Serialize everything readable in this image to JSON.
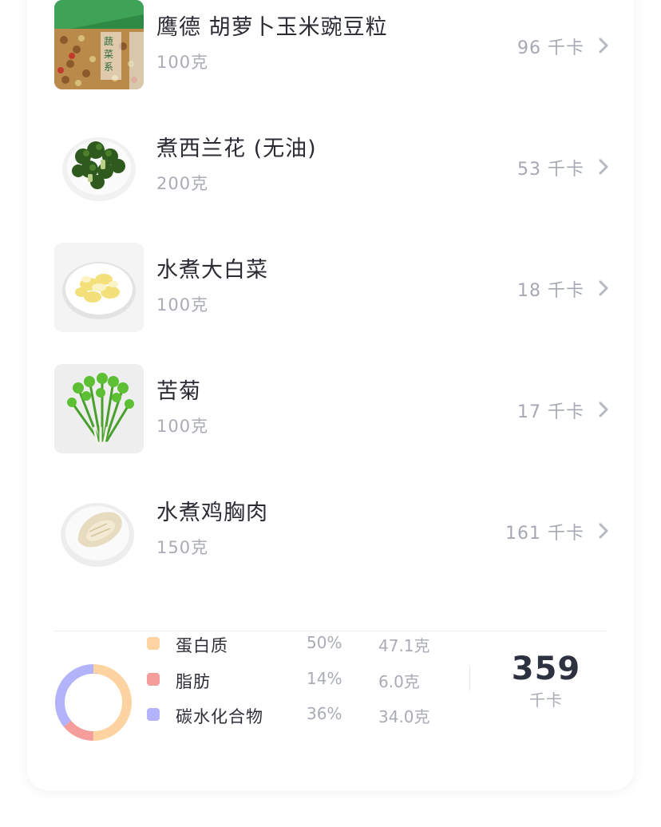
{
  "foods": [
    {
      "name": "鹰德 胡萝卜玉米豌豆粒",
      "amount": "100克",
      "calories": "96 千卡",
      "image": "frozen-vegetable-bag-photo"
    },
    {
      "name": "煮西兰花 (无油)",
      "amount": "200克",
      "calories": "53 千卡",
      "image": "broccoli-plate-photo"
    },
    {
      "name": "水煮大白菜",
      "amount": "100克",
      "calories": "18 千卡",
      "image": "cabbage-plate-photo"
    },
    {
      "name": "苦菊",
      "amount": "100克",
      "calories": "17 千卡",
      "image": "endive-photo"
    },
    {
      "name": "水煮鸡胸肉",
      "amount": "150克",
      "calories": "161 千卡",
      "image": "chicken-breast-plate-photo"
    }
  ],
  "summary": {
    "macros": [
      {
        "name": "蛋白质",
        "percent": "50%",
        "grams": "47.1克",
        "color": "#fcd3a1",
        "fraction": 0.5
      },
      {
        "name": "脂肪",
        "percent": "14%",
        "grams": "6.0克",
        "color": "#f59d9a",
        "fraction": 0.14
      },
      {
        "name": "碳水化合物",
        "percent": "36%",
        "grams": "34.0克",
        "color": "#b3b3fb",
        "fraction": 0.36
      }
    ],
    "total_calories": "359",
    "total_unit": "千卡"
  },
  "icons": {
    "row_chevron": "chevron-right-icon",
    "donut": "macro-donut-chart"
  }
}
